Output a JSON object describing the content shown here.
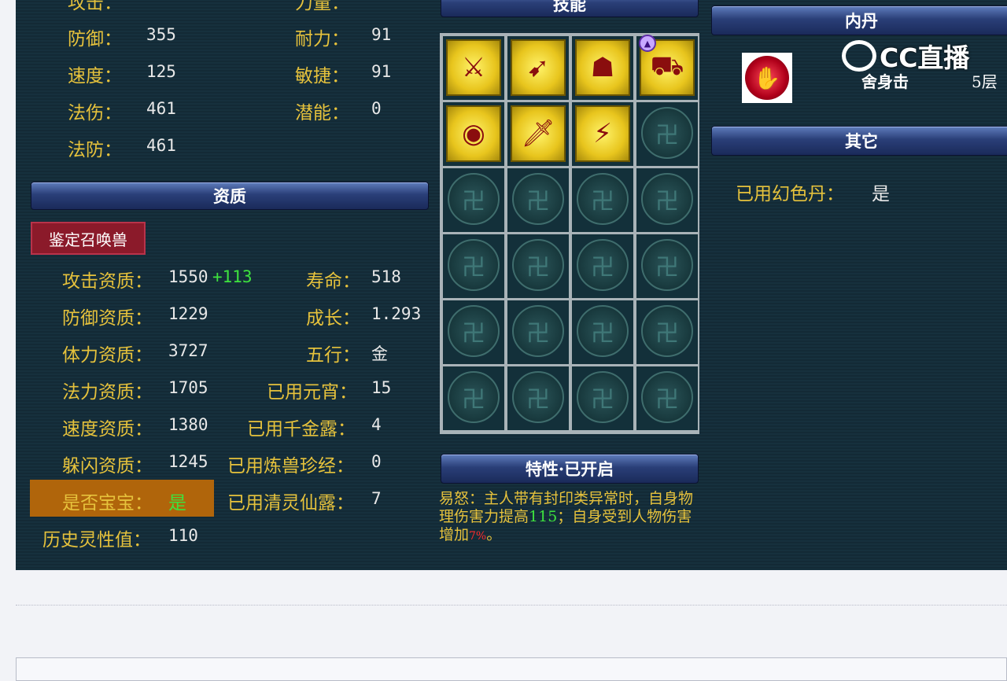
{
  "stats_top": [
    {
      "label": "防御：",
      "value": "355",
      "label2": "耐力：",
      "value2": "91"
    },
    {
      "label": "速度：",
      "value": "125",
      "label2": "敏捷：",
      "value2": "91"
    },
    {
      "label": "法伤：",
      "value": "461",
      "label2": "潜能：",
      "value2": "0"
    },
    {
      "label": "法防：",
      "value": "461"
    }
  ],
  "aptitude": {
    "title": "资质",
    "identify_button": "鉴定召唤兽",
    "rows": [
      {
        "label": "攻击资质：",
        "value": "1550",
        "bonus": "+113",
        "label2": "寿命：",
        "value2": "518"
      },
      {
        "label": "防御资质：",
        "value": "1229",
        "label2": "成长：",
        "value2": "1.293"
      },
      {
        "label": "体力资质：",
        "value": "3727",
        "label2": "五行：",
        "value2": "金"
      },
      {
        "label": "法力资质：",
        "value": "1705",
        "label2": "已用元宵：",
        "value2": "15"
      },
      {
        "label": "速度资质：",
        "value": "1380",
        "label2": "已用千金露：",
        "value2": "4"
      },
      {
        "label": "躲闪资质：",
        "value": "1245",
        "label2": "已用炼兽珍经：",
        "value2": "0"
      }
    ],
    "baby_label": "是否宝宝：",
    "baby_value": "是",
    "qingling_label": "已用清灵仙露：",
    "qingling_value": "7",
    "history_label": "历史灵性值：",
    "history_value": "110"
  },
  "skills": {
    "title": "技能",
    "icons": [
      "sword-pierce-icon",
      "bow-icon",
      "silhouette-icon",
      "chariot-icon",
      "eye-icon",
      "blade-icon",
      "beast-charge-icon"
    ]
  },
  "trait": {
    "title": "特性·已开启",
    "name": "易怒：",
    "text1": "主人带有封印类异常时，自身物理伤害力提高",
    "num1": "115",
    "text2": "；自身受到人物伤害增加",
    "num2": "7%",
    "text3": "。"
  },
  "neidan": {
    "title": "内丹",
    "skill_name": "舍身击",
    "level": "5层"
  },
  "other": {
    "title": "其它",
    "label": "已用幻色丹：",
    "value": "是"
  },
  "brand": {
    "text": "CC直播"
  }
}
